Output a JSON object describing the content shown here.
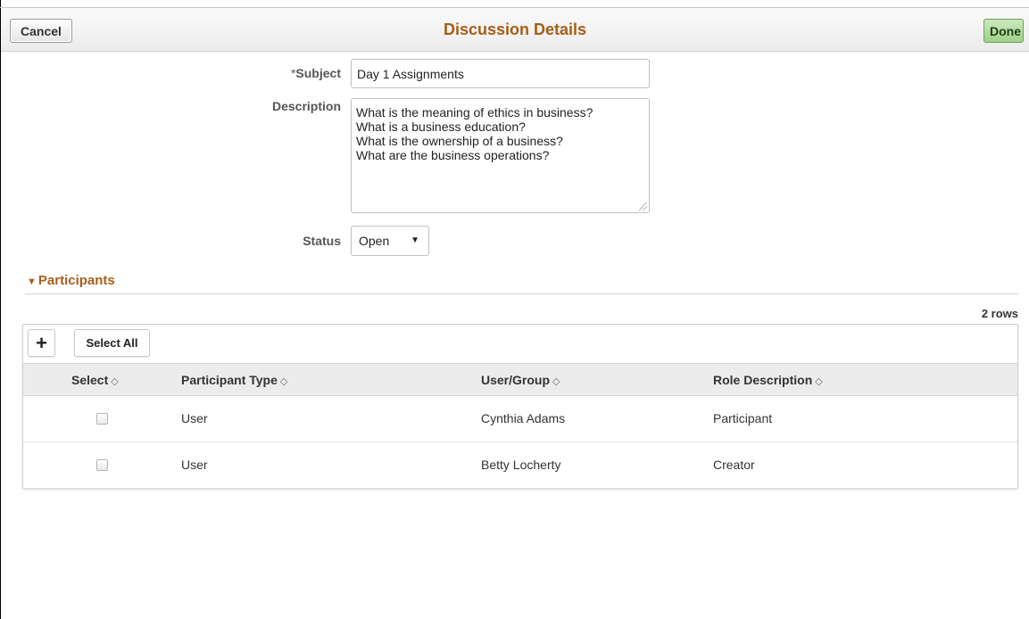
{
  "header": {
    "title": "Discussion Details",
    "cancel_label": "Cancel",
    "done_label": "Done"
  },
  "form": {
    "subject_required_marker": "*",
    "subject_label": "Subject",
    "subject_value": "Day 1 Assignments",
    "description_label": "Description",
    "description_value": "What is the meaning of ethics in business?\nWhat is a business education?\nWhat is the ownership of a business?\nWhat are the business operations?",
    "status_label": "Status",
    "status_value": "Open"
  },
  "participants": {
    "section_title": "Participants",
    "row_count": "2 rows",
    "add_icon": "plus-icon",
    "select_all_label": "Select All",
    "columns": [
      "Select",
      "Participant Type",
      "User/Group",
      "Role Description"
    ],
    "rows": [
      {
        "participant_type": "User",
        "user_group": "Cynthia Adams",
        "role_description": "Participant",
        "selected": false
      },
      {
        "participant_type": "User",
        "user_group": "Betty Locherty",
        "role_description": "Creator",
        "selected": false
      }
    ]
  },
  "colors": {
    "title": "#a75d17",
    "done_button": "#9fd18a"
  }
}
